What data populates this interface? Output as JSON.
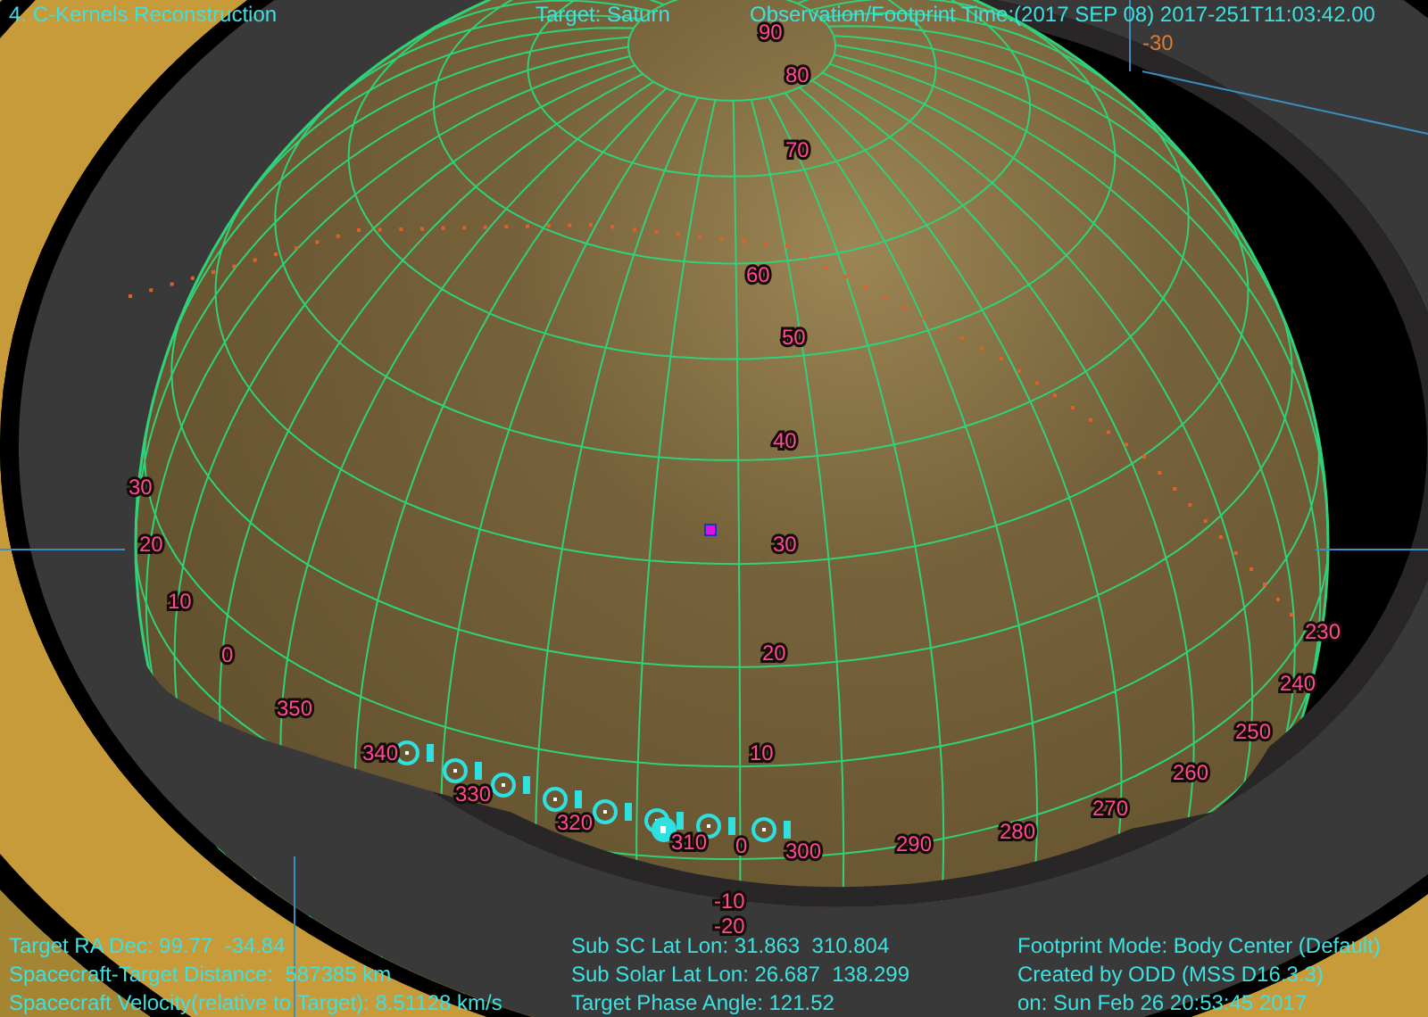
{
  "header": {
    "title": "4. C-Kernels Reconstruction",
    "target": "Target: Saturn",
    "time": "Observation/Footprint Time:(2017 SEP 08) 2017-251T11:03:42.00"
  },
  "globe": {
    "latitude_labels": [
      "90",
      "80",
      "70",
      "60",
      "50",
      "40",
      "30",
      "20",
      "10",
      "0",
      "-10",
      "-20"
    ],
    "longitude_labels": [
      "30",
      "20",
      "10",
      "0",
      "350",
      "340",
      "330",
      "320",
      "310",
      "300",
      "290",
      "280",
      "270",
      "260",
      "250",
      "240",
      "230"
    ],
    "ring_label": "-30"
  },
  "info": {
    "left": [
      "Target RA Dec: 99.77  -34.84",
      "Spacecraft-Target Distance:  587385 km",
      "Spacecraft Velocity(relative to Target): 8.51128 km/s"
    ],
    "middle": [
      "Sub SC Lat Lon: 31.863  310.804",
      "Sub Solar Lat Lon: 26.687  138.299",
      "Target Phase Angle: 121.52"
    ],
    "right": [
      "Footprint Mode: Body Center (Default)",
      "Created by ODD (MSS D16.3.3)",
      "on: Sun Feb 26 20:53:45 2017"
    ]
  }
}
